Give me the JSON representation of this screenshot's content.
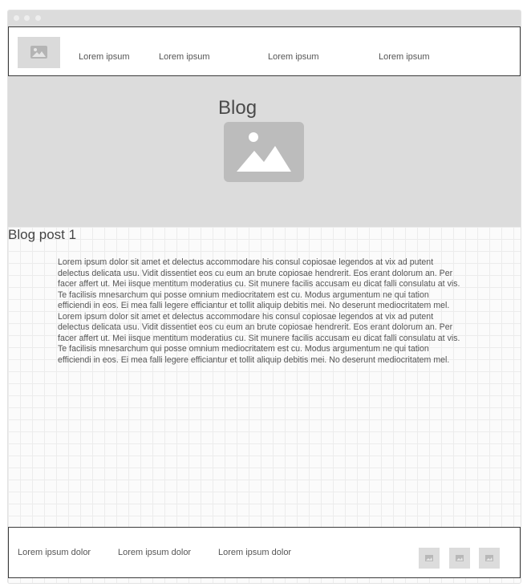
{
  "nav": {
    "logo_icon": "image-placeholder-icon",
    "links": [
      "Lorem ipsum",
      "Lorem ipsum",
      "Lorem ipsum",
      "Lorem ipsum"
    ]
  },
  "hero": {
    "title": "Blog",
    "image_icon": "image-placeholder-icon"
  },
  "post": {
    "title": "Blog post 1",
    "body": "Lorem ipsum dolor sit amet et delectus accommodare his consul copiosae legendos at vix ad putent delectus delicata usu. Vidit dissentiet eos cu eum an brute copiosae hendrerit. Eos erant dolorum an. Per facer affert ut. Mei iisque mentitum moderatius cu. Sit munere facilis accusam eu dicat falli consulatu at vis. Te facilisis mnesarchum qui posse omnium mediocritatem est cu. Modus argumentum ne qui tation efficiendi in eos. Ei mea falli legere efficiantur et tollit aliquip debitis mei. No deserunt mediocritatem mel. Lorem ipsum dolor sit amet et delectus accommodare his consul copiosae legendos at vix ad putent delectus delicata usu. Vidit dissentiet eos cu eum an brute copiosae hendrerit. Eos erant dolorum an. Per facer affert ut. Mei iisque mentitum moderatius cu. Sit munere facilis accusam eu dicat falli consulatu at vis. Te facilisis mnesarchum qui posse omnium mediocritatem est cu. Modus argumentum ne qui tation efficiendi in eos. Ei mea falli legere efficiantur et tollit aliquip debitis mei. No deserunt mediocritatem mel."
  },
  "footer": {
    "links": [
      "Lorem ipsum dolor",
      "Lorem ipsum dolor",
      "Lorem ipsum dolor"
    ],
    "social_icons": [
      "image-placeholder-icon",
      "image-placeholder-icon",
      "image-placeholder-icon"
    ]
  },
  "colors": {
    "placeholder_gray": "#dcdcdc",
    "image_gray": "#bcbcbc",
    "border_dark": "#3a3a3a",
    "text": "#555555"
  }
}
